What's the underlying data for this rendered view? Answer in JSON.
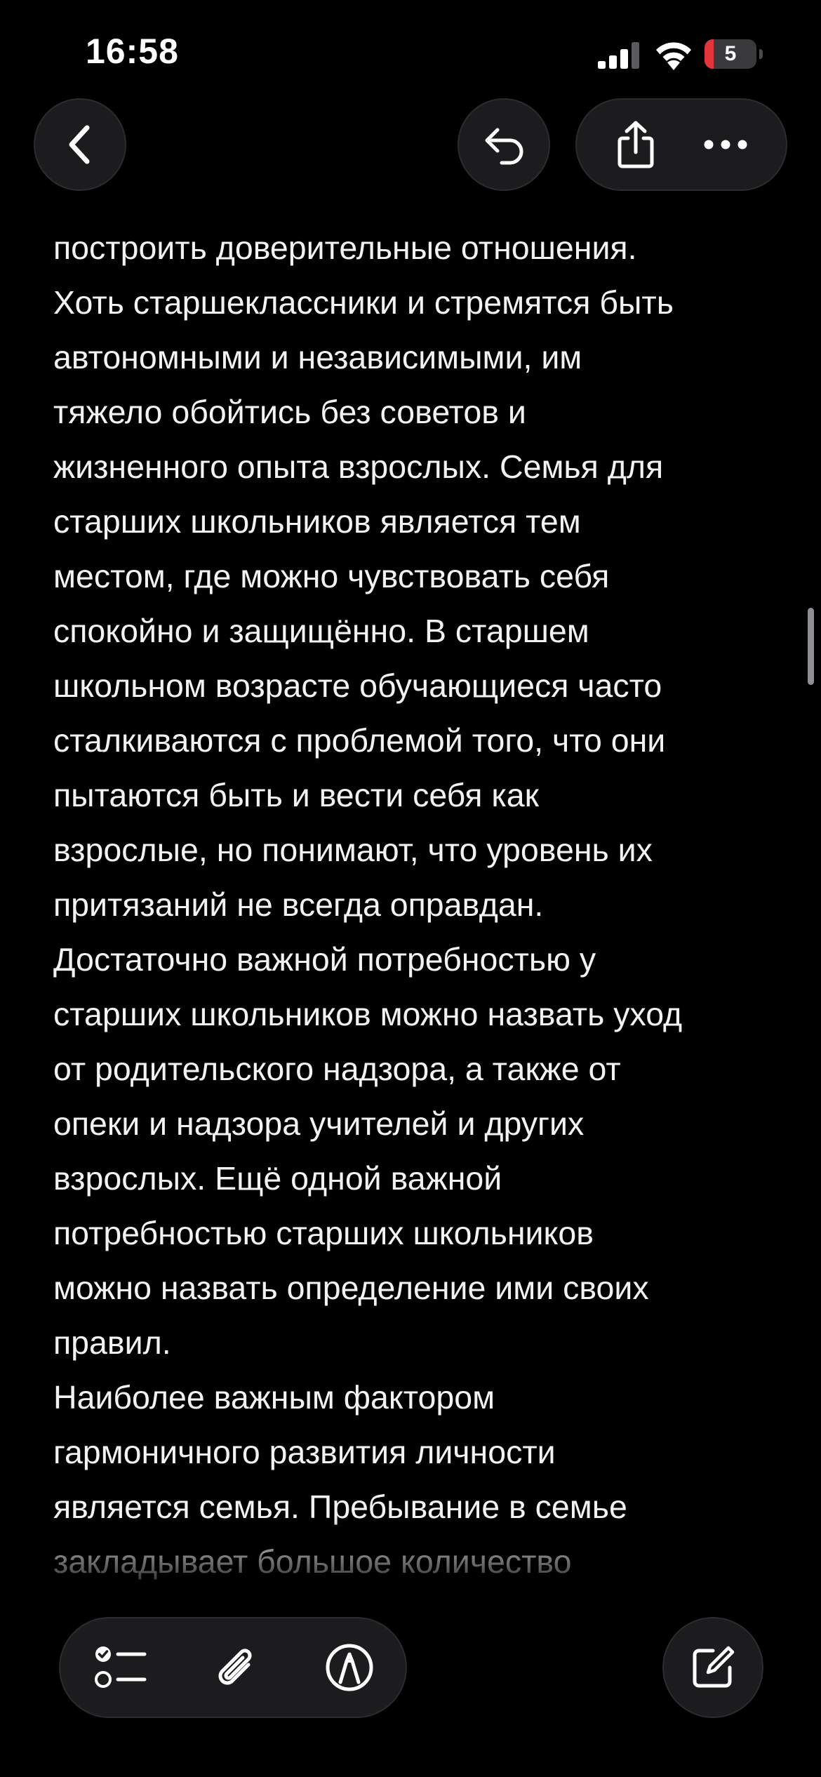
{
  "status_bar": {
    "time": "16:58",
    "battery_level": "5",
    "battery_fraction": 0.05,
    "icons": [
      "cellular-signal-icon",
      "wifi-icon",
      "battery-icon"
    ]
  },
  "nav": {
    "icons": [
      "chevron-left-icon",
      "undo-icon",
      "share-icon",
      "more-icon"
    ]
  },
  "note": {
    "lines": [
      "построить доверительные отношения.",
      "Хоть старшеклассники и стремятся быть",
      "автономными и независимыми, им",
      "тяжело обойтись без советов и",
      "жизненного опыта взрослых. Семья для",
      "старших школьников является тем",
      "местом, где можно чувствовать себя",
      "спокойно и защищённо. В старшем",
      "школьном возрасте обучающиеся часто",
      "сталкиваются с проблемой того, что они",
      "пытаются быть и вести себя как",
      "взрослые, но понимают, что уровень их",
      "притязаний не всегда оправдан.",
      "Достаточно важной потребностью у",
      "старших школьников можно назвать уход",
      "от родительского надзора, а также от",
      "опеки и надзора учителей и других",
      "взрослых. Ещё одной важной",
      "потребностью старших школьников",
      "можно назвать определение ими своих",
      "правил.",
      "Наиболее важным фактором",
      "гармоничного развития личности",
      "является семья. Пребывание в семье",
      "закладывает большое количество"
    ]
  },
  "toolbar": {
    "icons": [
      "checklist-icon",
      "paperclip-icon",
      "markup-pen-icon",
      "compose-icon"
    ]
  },
  "colors": {
    "background": "#000000",
    "text": "#f2f2f2",
    "button_bg": "#1c1c1e",
    "battery_red": "#e3353c"
  }
}
